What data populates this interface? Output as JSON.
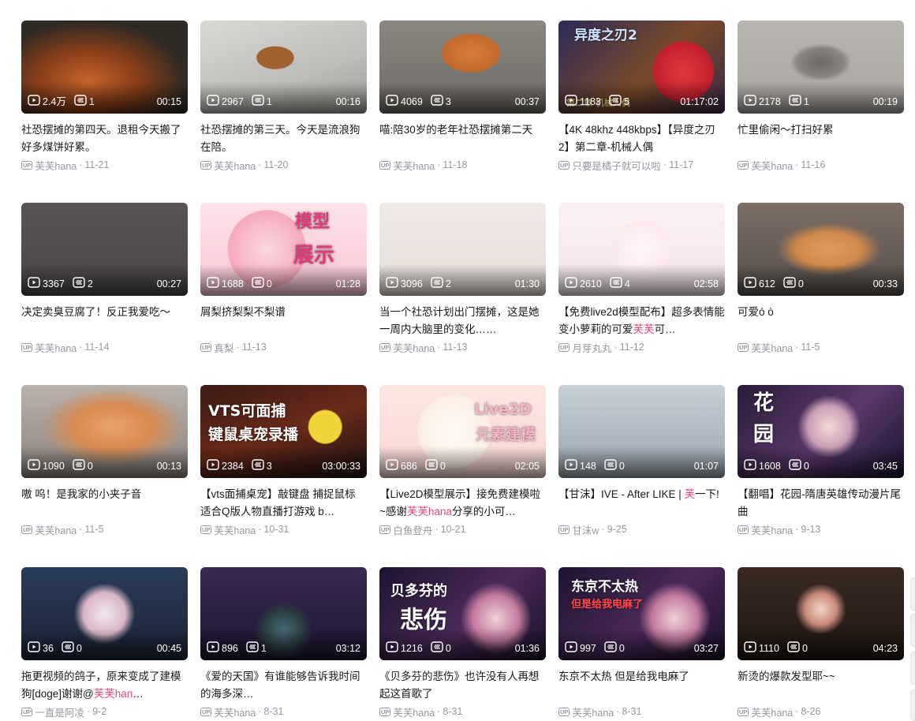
{
  "colors": {
    "highlight": "#e1487f",
    "meta": "#9499a0",
    "text": "#18191c"
  },
  "icons": {
    "play": "play-count-icon",
    "danmaku": "danmaku-icon",
    "up": "up-badge-icon"
  },
  "up_label": "UP",
  "videos": [
    {
      "views": "2.4万",
      "danmaku": "1",
      "duration": "00:15",
      "title": "社恐摆摊的第四天。退租今天搬了好多煤饼好累。",
      "author": "芙芙hana",
      "date": "11-21"
    },
    {
      "views": "2967",
      "danmaku": "1",
      "duration": "00:16",
      "title": "社恐摆摊的第三天。今天是流浪狗在陪。",
      "author": "芙芙hana",
      "date": "11-20"
    },
    {
      "views": "4069",
      "danmaku": "3",
      "duration": "00:37",
      "title": "喵:陪30岁的老年社恐摆摊第二天",
      "author": "芙芙hana",
      "date": "11-18"
    },
    {
      "views": "1183",
      "danmaku": "5",
      "duration": "01:17:02",
      "title": "【4K 48khz 448kbps】【异度之刃2】第二章-机械人偶",
      "author": "只要是橘子就可以啦",
      "date": "11-17",
      "overlay": "异度之刃2",
      "overlay2": "第二章 机械人偶"
    },
    {
      "views": "2178",
      "danmaku": "1",
      "duration": "00:19",
      "title": "忙里偷闲～打扫好累",
      "author": "芙芙hana",
      "date": "11-16"
    },
    {
      "views": "3367",
      "danmaku": "2",
      "duration": "00:27",
      "title": "决定卖臭豆腐了！反正我爱吃～",
      "author": "芙芙hana",
      "date": "11-14"
    },
    {
      "views": "1688",
      "danmaku": "0",
      "duration": "01:28",
      "title": "屑梨挤梨梨不梨谱",
      "author": "真梨",
      "date": "11-13",
      "overlay": "模型",
      "overlay2": "展示"
    },
    {
      "views": "3096",
      "danmaku": "2",
      "duration": "01:30",
      "title": "当一个社恐计划出门摆摊，这是她一周内大脑里的变化……",
      "author": "芙芙hana",
      "date": "11-13"
    },
    {
      "views": "2610",
      "danmaku": "4",
      "duration": "02:58",
      "title_parts": [
        "【免费live2d模型配布】超多表情能变小萝莉的可爱",
        "芙芙",
        "可…"
      ],
      "author": "月芽丸丸",
      "date": "11-12"
    },
    {
      "views": "612",
      "danmaku": "0",
      "duration": "00:33",
      "title": "可爱ó ò",
      "author": "芙芙hana",
      "date": "11-5"
    },
    {
      "views": "1090",
      "danmaku": "0",
      "duration": "00:13",
      "title": "嗷 呜！是我家的小夹子音",
      "author": "芙芙hana",
      "date": "11-5"
    },
    {
      "views": "2384",
      "danmaku": "3",
      "duration": "03:00:33",
      "title": "【vts面捕桌宠】敲键盘 捕捉鼠标 适合Q版人物直播打游戏 b…",
      "author": "芙芙hana",
      "date": "10-31",
      "overlay": "VTS可面捕",
      "overlay2": "键鼠桌宠录播"
    },
    {
      "views": "686",
      "danmaku": "0",
      "duration": "02:05",
      "title_parts": [
        "【Live2D模型展示】接免费建模啦~感谢",
        "芙芙hana",
        "分享的小可…"
      ],
      "author": "白鱼登舟",
      "date": "10-21",
      "overlay": "Live2D",
      "overlay2": "元素建模"
    },
    {
      "views": "148",
      "danmaku": "0",
      "duration": "01:07",
      "title_parts": [
        "【甘沫】IVE - After LIKE | ",
        "芙",
        "一下!"
      ],
      "author": "甘沫w",
      "date": "9-25"
    },
    {
      "views": "1608",
      "danmaku": "0",
      "duration": "03:45",
      "title": "【翻唱】花园-隋唐英雄传动漫片尾曲",
      "author": "芙芙hana",
      "date": "9-13",
      "overlay": "花",
      "overlay2": "园"
    },
    {
      "views": "36",
      "danmaku": "0",
      "duration": "00:45",
      "title_parts": [
        "拖更视频的鸽子，原来变成了建模狗[doge]谢谢@",
        "芙芙han",
        "…"
      ],
      "author": "一直是阿凌",
      "date": "9-2"
    },
    {
      "views": "896",
      "danmaku": "1",
      "duration": "03:12",
      "title": "《爱的天国》有谁能够告诉我时间的海多深…",
      "author": "芙芙hana",
      "date": "8-31"
    },
    {
      "views": "1216",
      "danmaku": "0",
      "duration": "01:36",
      "title": "《贝多芬的悲伤》也许没有人再想起这首歌了",
      "author": "芙芙hana",
      "date": "8-31",
      "overlay": "贝多芬的",
      "overlay2": "悲伤"
    },
    {
      "views": "997",
      "danmaku": "0",
      "duration": "03:27",
      "title": "东京不太热 但是给我电麻了",
      "author": "芙芙hana",
      "date": "8-31",
      "overlay": "东京不太热",
      "overlay2": "但是给我电麻了"
    },
    {
      "views": "1110",
      "danmaku": "0",
      "duration": "04:23",
      "title": "新烫的爆款发型耶~~",
      "author": "芙芙hana",
      "date": "8-26"
    }
  ]
}
